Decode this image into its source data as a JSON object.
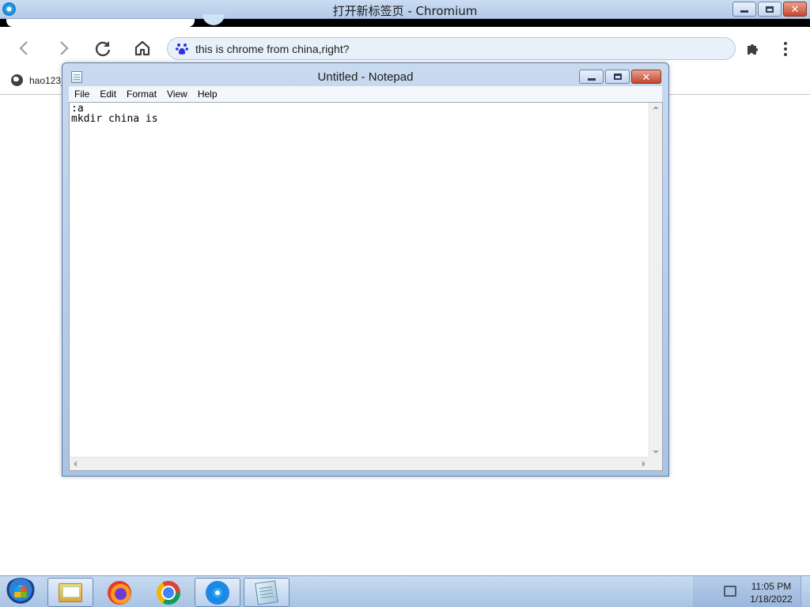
{
  "chromium": {
    "window_title": "打开新标签页 - Chromium",
    "address_bar_text": "this is chrome from china,right?",
    "bookmarks": [
      {
        "label": "hao123_"
      }
    ]
  },
  "notepad": {
    "window_title": "Untitled - Notepad",
    "menu": [
      "File",
      "Edit",
      "Format",
      "View",
      "Help"
    ],
    "content": ":a\nmkdir china is"
  },
  "taskbar": {
    "apps": [
      "explorer-icon",
      "firefox-icon",
      "chrome-icon",
      "chromium-icon",
      "notepad-icon"
    ],
    "clock_time": "11:05 PM",
    "clock_date": "1/18/2022"
  },
  "colors": {
    "taskbar": "#a8c3e4",
    "omnibox": "#e8f0fa",
    "close_button": "#c6462c"
  }
}
